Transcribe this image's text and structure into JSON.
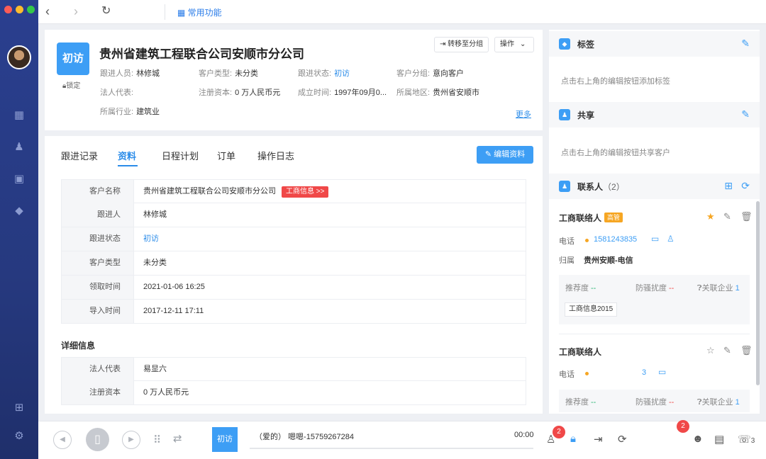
{
  "window": {
    "controls": [
      "close",
      "minimize",
      "zoom"
    ]
  },
  "topbar": {
    "common_label": "常用功能"
  },
  "company": {
    "badge": "初访",
    "lock_label": "锁定",
    "name": "贵州省建筑工程联合公司安顺市分公司",
    "move_group": "转移至分组",
    "action": "操作",
    "more": "更多",
    "info": {
      "follower_label": "跟进人员:",
      "follower": "林修城",
      "type_label": "客户类型:",
      "type": "未分类",
      "status_label": "跟进状态:",
      "status": "初访",
      "group_label": "客户分组:",
      "group": "意向客户",
      "legal_label": "法人代表:",
      "legal": "",
      "capital_label": "注册资本:",
      "capital": "0 万人民币元",
      "founded_label": "成立时间:",
      "founded": "1997年09月0...",
      "region_label": "所属地区:",
      "region": "贵州省安顺市",
      "industry_label": "所属行业:",
      "industry": "建筑业"
    }
  },
  "tabs": [
    "跟进记录",
    "资料",
    "日程计划",
    "订单",
    "操作日志"
  ],
  "edit_button": "编辑资料",
  "profile": {
    "rows": [
      {
        "label": "客户名称",
        "value": "贵州省建筑工程联合公司安顺市分公司",
        "tag": "工商信息 >>"
      },
      {
        "label": "跟进人",
        "value": "林修城"
      },
      {
        "label": "跟进状态",
        "value": "初访"
      },
      {
        "label": "客户类型",
        "value": "未分类"
      },
      {
        "label": "领取时间",
        "value": "2021-01-06 16:25"
      },
      {
        "label": "导入时间",
        "value": "2017-12-11 17:11"
      }
    ],
    "detail_title": "详细信息",
    "detail_rows": [
      {
        "label": "法人代表",
        "value": "易显六"
      },
      {
        "label": "注册资本",
        "value": "0 万人民币元"
      }
    ]
  },
  "right": {
    "tags": {
      "title": "标签",
      "hint": "点击右上角的编辑按钮添加标签"
    },
    "share": {
      "title": "共享",
      "hint": "点击右上角的编辑按钮共享客户"
    },
    "contacts": {
      "title": "联系人",
      "count": "（2）",
      "items": [
        {
          "name": "工商联络人",
          "tag": "高管",
          "phone_label": "电话",
          "phone": "1581243835",
          "attr_label": "归属",
          "attr": "贵州安顺-电信",
          "rec_label": "推荐度",
          "rec": "--",
          "dnd_label": "防骚扰度",
          "dnd": "--",
          "rel_label": "关联企业",
          "rel": "1",
          "biz_tag": "工商信息2015"
        },
        {
          "name": "工商联络人",
          "phone_label": "电话",
          "phone": "3",
          "rec_label": "推荐度",
          "rec": "--",
          "dnd_label": "防骚扰度",
          "dnd": "--",
          "rel_label": "关联企业",
          "rel": "1"
        }
      ]
    }
  },
  "call": {
    "badge": "初访",
    "info": "（爱的）    嗯嗯-15759267284",
    "time": "00:00",
    "badge_count_1": "2",
    "badge_count_2": "2",
    "phone_count": "3"
  }
}
